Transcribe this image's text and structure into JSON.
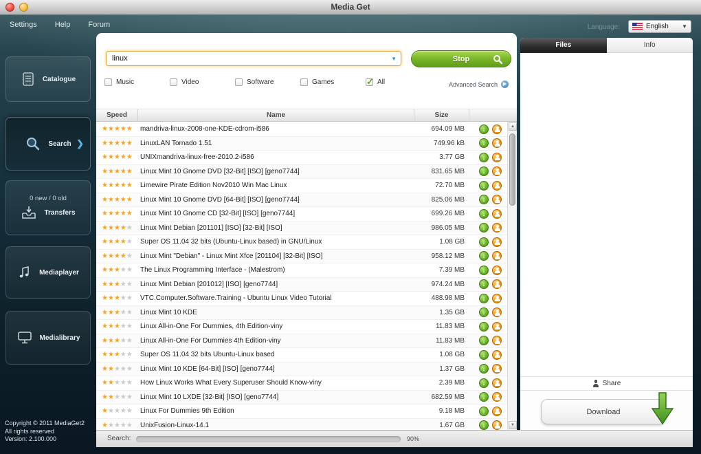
{
  "window": {
    "title": "Media Get"
  },
  "menubar": {
    "items": [
      "Settings",
      "Help",
      "Forum"
    ],
    "language_label": "Language:",
    "language_value": "English"
  },
  "sidebar": {
    "items": [
      {
        "label": "Catalogue"
      },
      {
        "label": "Search"
      },
      {
        "label": "Transfers",
        "badge": "0 new / 0 old"
      },
      {
        "label": "Mediaplayer"
      },
      {
        "label": "Medialibrary"
      }
    ],
    "copyright": [
      "Copyright © 2011 MediaGet2",
      "All rights reserved",
      "Version: 2.100.000"
    ]
  },
  "search_bar": {
    "query": "linux",
    "stop_label": "Stop",
    "advanced_label": "Advanced Search",
    "filters": [
      {
        "label": "Music",
        "checked": false
      },
      {
        "label": "Video",
        "checked": false
      },
      {
        "label": "Software",
        "checked": false
      },
      {
        "label": "Games",
        "checked": false
      },
      {
        "label": "All",
        "checked": true
      }
    ]
  },
  "results": {
    "columns": [
      "Speed",
      "Name",
      "Size"
    ],
    "rows": [
      {
        "rating": 5,
        "name": "mandriva-linux-2008-one-KDE-cdrom-i586",
        "size": "694.09 MB"
      },
      {
        "rating": 5,
        "name": "LinuxLAN Tornado 1.51",
        "size": "749.96 kB"
      },
      {
        "rating": 5,
        "name": "UNIXmandriva-linux-free-2010.2-i586",
        "size": "3.77 GB"
      },
      {
        "rating": 5,
        "name": "Linux Mint 10 Gnome DVD [32-Bit] [ISO] [geno7744]",
        "size": "831.65 MB"
      },
      {
        "rating": 5,
        "name": "Limewire Pirate Edition Nov2010 Win Mac Linux",
        "size": "72.70 MB"
      },
      {
        "rating": 5,
        "name": "Linux Mint 10 Gnome DVD [64-Bit] [ISO] [geno7744]",
        "size": "825.06 MB"
      },
      {
        "rating": 5,
        "name": "Linux Mint 10 Gnome CD [32-Bit] [ISO] [geno7744]",
        "size": "699.26 MB"
      },
      {
        "rating": 4,
        "name": "Linux Mint Debian [201101] [ISO] [32-Bit] [ISO]",
        "size": "986.05 MB"
      },
      {
        "rating": 4,
        "name": "Super OS 11.04 32 bits (Ubuntu-Linux based) in GNU/Linux",
        "size": "1.08 GB"
      },
      {
        "rating": 4,
        "name": "Linux Mint \"Debian\" - Linux Mint Xfce [201104] [32-Bit] [ISO]",
        "size": "958.12 MB"
      },
      {
        "rating": 3,
        "name": "The Linux Programming Interface - (Malestrom)",
        "size": "7.39 MB"
      },
      {
        "rating": 3,
        "name": "Linux Mint Debian [201012] [ISO] [geno7744]",
        "size": "974.24 MB"
      },
      {
        "rating": 3,
        "name": "VTC.Computer.Software.Training - Ubuntu Linux Video Tutorial",
        "size": "488.98 MB"
      },
      {
        "rating": 3,
        "name": "Linux Mint 10 KDE",
        "size": "1.35 GB"
      },
      {
        "rating": 3,
        "name": "Linux All-in-One For Dummies, 4th Edition-viny",
        "size": "11.83 MB"
      },
      {
        "rating": 3,
        "name": "Linux All-in-One For Dummies 4th Edition-viny",
        "size": "11.83 MB"
      },
      {
        "rating": 3,
        "name": "Super OS 11.04 32 bits Ubuntu-Linux based",
        "size": "1.08 GB"
      },
      {
        "rating": 2,
        "name": "Linux Mint 10 KDE [64-Bit] [ISO] [geno7744]",
        "size": "1.37 GB"
      },
      {
        "rating": 2,
        "name": "How Linux Works What Every Superuser Should Know-viny",
        "size": "2.39 MB"
      },
      {
        "rating": 2,
        "name": "Linux Mint 10 LXDE [32-Bit] [ISO] [geno7744]",
        "size": "682.59 MB"
      },
      {
        "rating": 1,
        "name": "Linux For Dummies 9th Edition",
        "size": "9.18 MB"
      },
      {
        "rating": 1,
        "name": "UnixFusion-Linux-14.1",
        "size": "1.67 GB"
      }
    ]
  },
  "right_panel": {
    "tabs": [
      "Files",
      "Info"
    ],
    "share_label": "Share",
    "download_label": "Download"
  },
  "statusbar": {
    "label": "Search:",
    "percent_text": "90%",
    "progress_percent": 90
  },
  "colors": {
    "accent_green": "#7cb82a",
    "star_orange": "#f6a41f",
    "tab_dark": "#2b2b2b",
    "progress_green": "#7cb342",
    "download_circle": "#6cb52c",
    "user_circle": "#ef9a19"
  }
}
